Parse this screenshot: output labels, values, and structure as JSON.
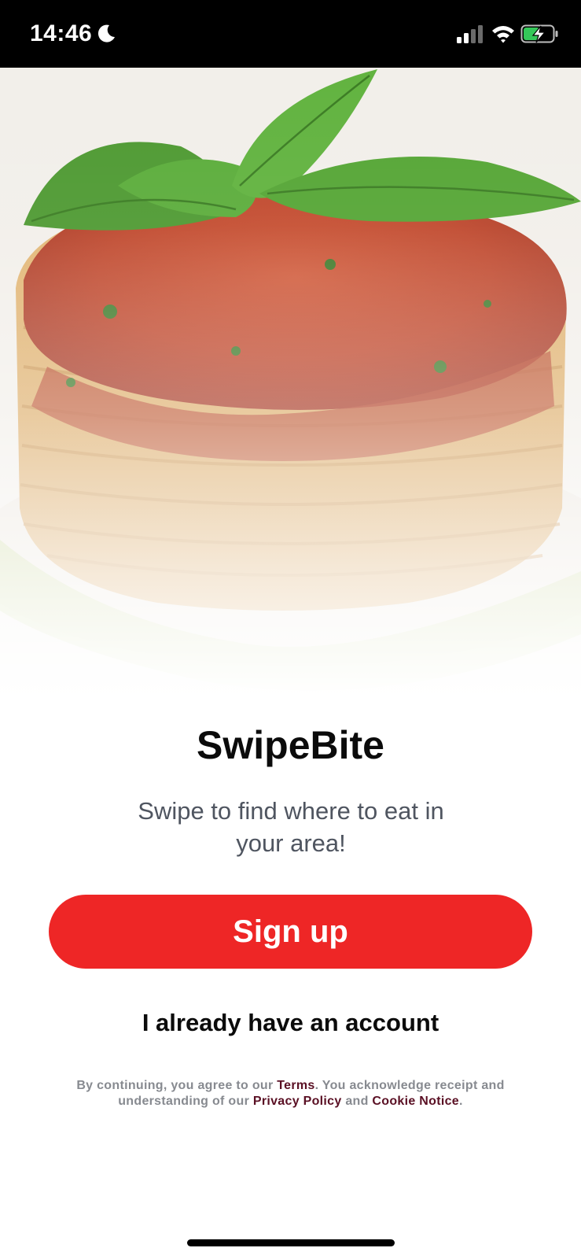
{
  "status_bar": {
    "time": "14:46",
    "icons": [
      "moon-icon",
      "signal-icon",
      "wifi-icon",
      "battery-charging-icon"
    ]
  },
  "hero": {
    "image": "pasta-with-basil-photo"
  },
  "app": {
    "title": "SwipeBite",
    "tagline": "Swipe to find where to eat in your area!"
  },
  "actions": {
    "signup_label": "Sign up",
    "login_label": "I already have an account"
  },
  "legal": {
    "prefix": "By continuing, you agree to our ",
    "terms": "Terms",
    "middle": ". You acknowledge receipt and understanding of our ",
    "privacy": "Privacy Policy",
    "and": " and ",
    "cookie": "Cookie Notice",
    "suffix": "."
  },
  "colors": {
    "accent": "#ee2626",
    "link": "#5a1024",
    "tagline": "#4f5560"
  }
}
